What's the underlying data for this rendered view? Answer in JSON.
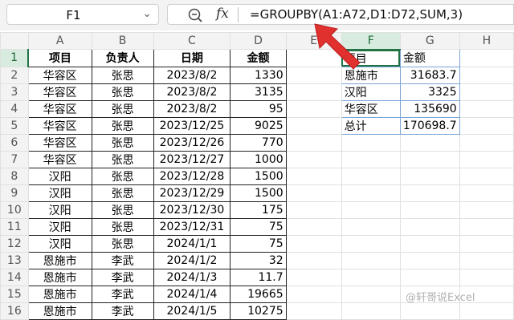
{
  "namebox": {
    "value": "F1"
  },
  "formula_bar": {
    "formula": "=GROUPBY(A1:A72,D1:D72,SUM,3)",
    "fx_label": "fx"
  },
  "columns": [
    "A",
    "B",
    "C",
    "D",
    "E",
    "F",
    "G",
    "H"
  ],
  "rows": [
    "1",
    "2",
    "3",
    "4",
    "5",
    "6",
    "7",
    "8",
    "9",
    "10",
    "11",
    "12",
    "13",
    "14",
    "15",
    "16"
  ],
  "source_header": [
    "项目",
    "负责人",
    "日期",
    "金额"
  ],
  "source_rows": [
    [
      "华容区",
      "张思",
      "2023/8/2",
      "1330"
    ],
    [
      "华容区",
      "张思",
      "2023/8/2",
      "3135"
    ],
    [
      "华容区",
      "张思",
      "2023/8/2",
      "95"
    ],
    [
      "华容区",
      "张思",
      "2023/12/25",
      "9025"
    ],
    [
      "华容区",
      "张思",
      "2023/12/26",
      "770"
    ],
    [
      "华容区",
      "张思",
      "2023/12/27",
      "1000"
    ],
    [
      "汉阳",
      "张思",
      "2023/12/28",
      "1500"
    ],
    [
      "汉阳",
      "张思",
      "2023/12/29",
      "1500"
    ],
    [
      "汉阳",
      "张思",
      "2023/12/30",
      "175"
    ],
    [
      "汉阳",
      "张思",
      "2023/12/31",
      "75"
    ],
    [
      "汉阳",
      "张思",
      "2024/1/1",
      "75"
    ],
    [
      "恩施市",
      "李武",
      "2024/1/2",
      "32"
    ],
    [
      "恩施市",
      "李武",
      "2024/1/3",
      "11.7"
    ],
    [
      "恩施市",
      "李武",
      "2024/1/4",
      "19665"
    ],
    [
      "恩施市",
      "李武",
      "2024/1/5",
      "10275"
    ]
  ],
  "result_header": [
    "项目",
    "金额"
  ],
  "result_rows": [
    [
      "恩施市",
      "31683.7"
    ],
    [
      "汉阳",
      "3325"
    ],
    [
      "华容区",
      "135690"
    ],
    [
      "总计",
      "170698.7"
    ]
  ],
  "watermark": "@轩哥说Excel",
  "colors": {
    "selection": "#217346",
    "arrow": "#e0312f",
    "spill_border": "#7aa5d8"
  }
}
